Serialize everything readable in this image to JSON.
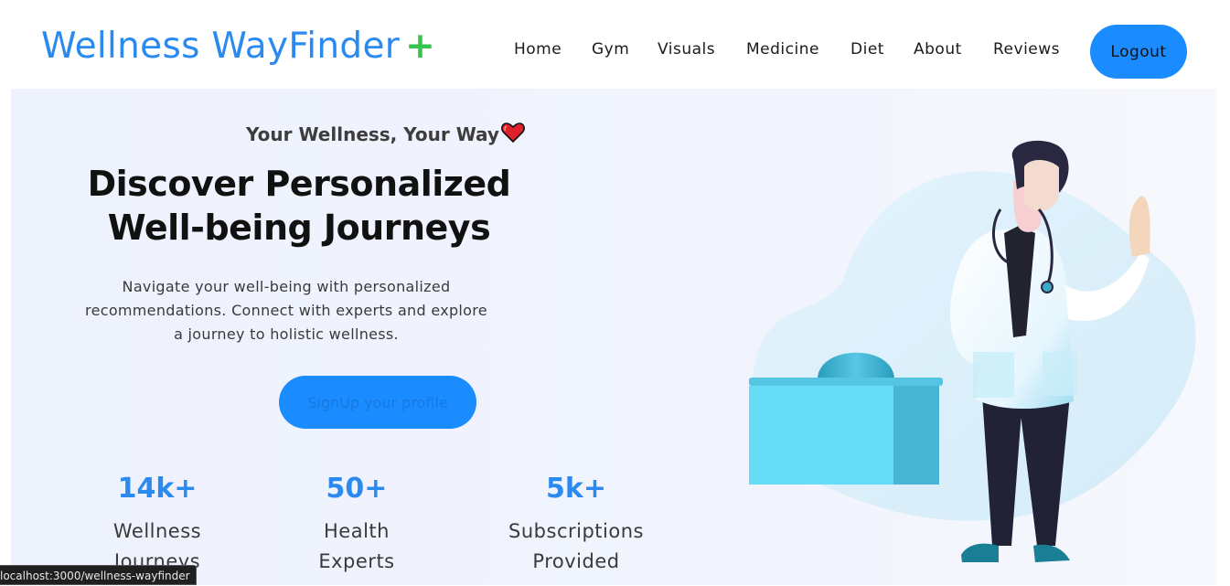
{
  "brand": {
    "name": "Wellness WayFinder",
    "plus": "+"
  },
  "nav": {
    "links": [
      "Home",
      "Gym",
      "Visuals",
      "Medicine",
      "Diet",
      "About",
      "Reviews"
    ],
    "logout_label": "Logout"
  },
  "hero": {
    "tagline": "Your Wellness, Your Way",
    "headline_line1": "Discover Personalized",
    "headline_line2": "Well-being Journeys",
    "description": "Navigate your well-being with personalized recommendations. Connect with experts and explore a journey to holistic wellness.",
    "signup_label": "SignUp your profile"
  },
  "stats": [
    {
      "value": "14k+",
      "label": "Wellness Journeys"
    },
    {
      "value": "50+",
      "label": "Health Experts"
    },
    {
      "value": "5k+",
      "label": "Subscriptions Provided"
    }
  ],
  "status_bar": {
    "url": "localhost:3000/wellness-wayfinder"
  },
  "colors": {
    "accent": "#1a8cff",
    "brand_text": "#2b8af0",
    "plus": "#34c64a"
  }
}
